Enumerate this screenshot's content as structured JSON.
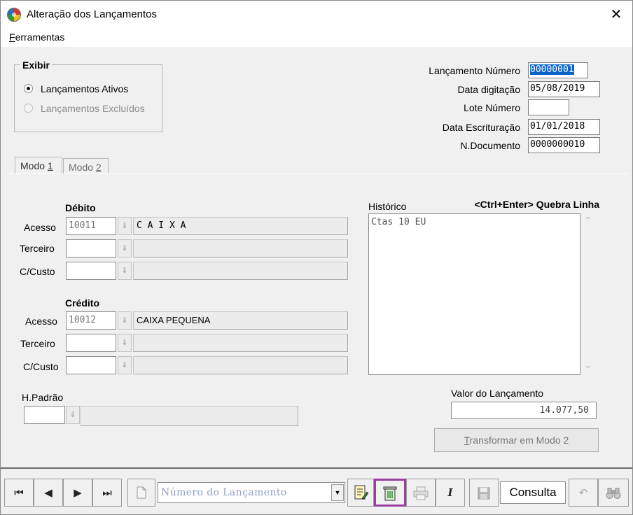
{
  "window": {
    "title": "Alteração dos Lançamentos",
    "close_glyph": "✕"
  },
  "menu": {
    "ferramentas_first": "F",
    "ferramentas_rest": "erramentas"
  },
  "exibir": {
    "legend": "Exibir",
    "option_ativos": "Lançamentos Ativos",
    "option_excluidos": "Lançamentos Excluídos",
    "selected": "ativos"
  },
  "header_fields": {
    "lancamento_numero_label": "Lançamento Número",
    "lancamento_numero_value": "00000001",
    "data_digitacao_label": "Data digitação",
    "data_digitacao_value": "05/08/2019",
    "lote_numero_label": "Lote Número",
    "lote_numero_value": "",
    "data_escrituracao_label": "Data Escrituração",
    "data_escrituracao_value": "01/01/2018",
    "n_documento_label": "N.Documento",
    "n_documento_value": "0000000010"
  },
  "tabs": {
    "modo1_prefix": "Modo ",
    "modo1_key": "1",
    "modo2_prefix": "Modo ",
    "modo2_key": "2"
  },
  "debito": {
    "title": "Débito",
    "acesso_label": "Acesso",
    "acesso_value": "10011",
    "acesso_desc": "C A I X A",
    "terceiro_label": "Terceiro",
    "custo_label": "C/Custo"
  },
  "credito": {
    "title": "Crédito",
    "acesso_label": "Acesso",
    "acesso_value": "10012",
    "acesso_desc": "CAIXA PEQUENA",
    "terceiro_label": "Terceiro",
    "custo_label": "C/Custo"
  },
  "hpadrao": {
    "label": "H.Padrão"
  },
  "historico": {
    "label": "Histórico",
    "hint": "<Ctrl+Enter> Quebra Linha",
    "text": "Ctas 10 EU"
  },
  "valor": {
    "label": "Valor do Lançamento",
    "value": "14.077,50"
  },
  "transformar": {
    "label_first": "T",
    "label_rest": "ransformar em  Modo 2"
  },
  "toolbar": {
    "first_glyph": "⏮",
    "prev_glyph": "◀",
    "next_glyph": "▶",
    "last_glyph": "⏭",
    "numero_placeholder": "Número do Lançamento",
    "consulta": "Consulta",
    "italic_glyph": "I",
    "undo_glyph": "↶",
    "find_glyph": "⌕"
  },
  "colors": {
    "selection": "#0a64c8",
    "highlight": "#9a3ea0"
  }
}
